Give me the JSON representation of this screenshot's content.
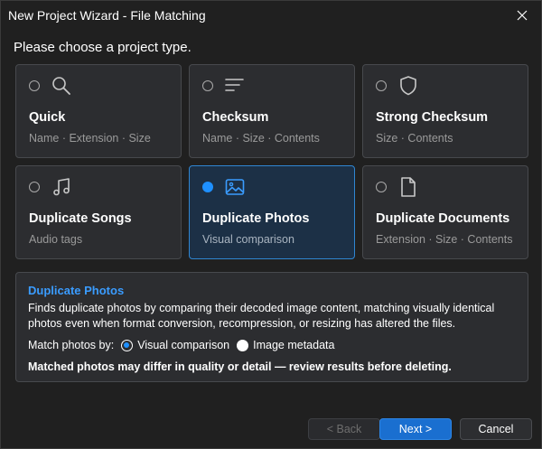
{
  "window": {
    "title": "New Project Wizard - File Matching"
  },
  "prompt": "Please choose a project type.",
  "cards": [
    {
      "name": "Quick",
      "sub": "Name · Extension · Size",
      "icon": "search-icon",
      "selected": false
    },
    {
      "name": "Checksum",
      "sub": "Name · Size · Contents",
      "icon": "lines-icon",
      "selected": false
    },
    {
      "name": "Strong Checksum",
      "sub": "Size · Contents",
      "icon": "shield-icon",
      "selected": false
    },
    {
      "name": "Duplicate Songs",
      "sub": "Audio tags",
      "icon": "music-note-icon",
      "selected": false
    },
    {
      "name": "Duplicate Photos",
      "sub": "Visual comparison",
      "icon": "image-icon",
      "selected": true
    },
    {
      "name": "Duplicate Documents",
      "sub": "Extension · Size · Contents",
      "icon": "document-icon",
      "selected": false
    }
  ],
  "detail": {
    "title": "Duplicate Photos",
    "body": "Finds duplicate photos by comparing their decoded image content, matching visually identical photos even when format conversion, recompression, or resizing has altered the files.",
    "match_label": "Match photos by:",
    "options": [
      {
        "label": "Visual comparison",
        "selected": true
      },
      {
        "label": "Image metadata",
        "selected": false
      }
    ],
    "warning": "Matched photos may differ in quality or detail — review results before deleting."
  },
  "buttons": {
    "back": "< Back",
    "next": "Next >",
    "cancel": "Cancel"
  },
  "colors": {
    "accent": "#1e90ff",
    "detail_title": "#3a9cff",
    "selected_card_bg": "#1c3046",
    "selected_card_border": "#2f86d2"
  }
}
